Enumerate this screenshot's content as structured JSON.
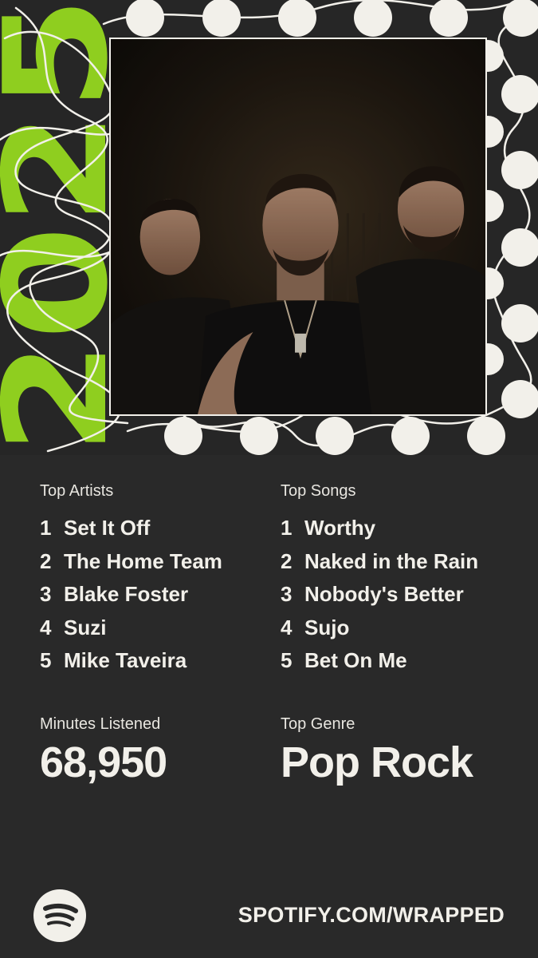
{
  "year_graphic": "2025",
  "top_artists": {
    "label": "Top Artists",
    "items": [
      {
        "rank": "1",
        "name": "Set It Off"
      },
      {
        "rank": "2",
        "name": "The Home Team"
      },
      {
        "rank": "3",
        "name": "Blake Foster"
      },
      {
        "rank": "4",
        "name": "Suzi"
      },
      {
        "rank": "5",
        "name": "Mike Taveira"
      }
    ]
  },
  "top_songs": {
    "label": "Top Songs",
    "items": [
      {
        "rank": "1",
        "name": "Worthy"
      },
      {
        "rank": "2",
        "name": "Naked in the Rain"
      },
      {
        "rank": "3",
        "name": "Nobody's Better"
      },
      {
        "rank": "4",
        "name": "Sujo"
      },
      {
        "rank": "5",
        "name": "Bet On Me"
      }
    ]
  },
  "minutes": {
    "label": "Minutes Listened",
    "value": "68,950"
  },
  "genre": {
    "label": "Top Genre",
    "value": "Pop Rock"
  },
  "footer": {
    "logo_icon": "spotify-logo-icon",
    "url": "SPOTIFY.COM/WRAPPED"
  },
  "colors": {
    "accent": "#8fce1f",
    "background": "#292929",
    "dots": "#f2f0ea",
    "text": "#f2f0ea"
  }
}
